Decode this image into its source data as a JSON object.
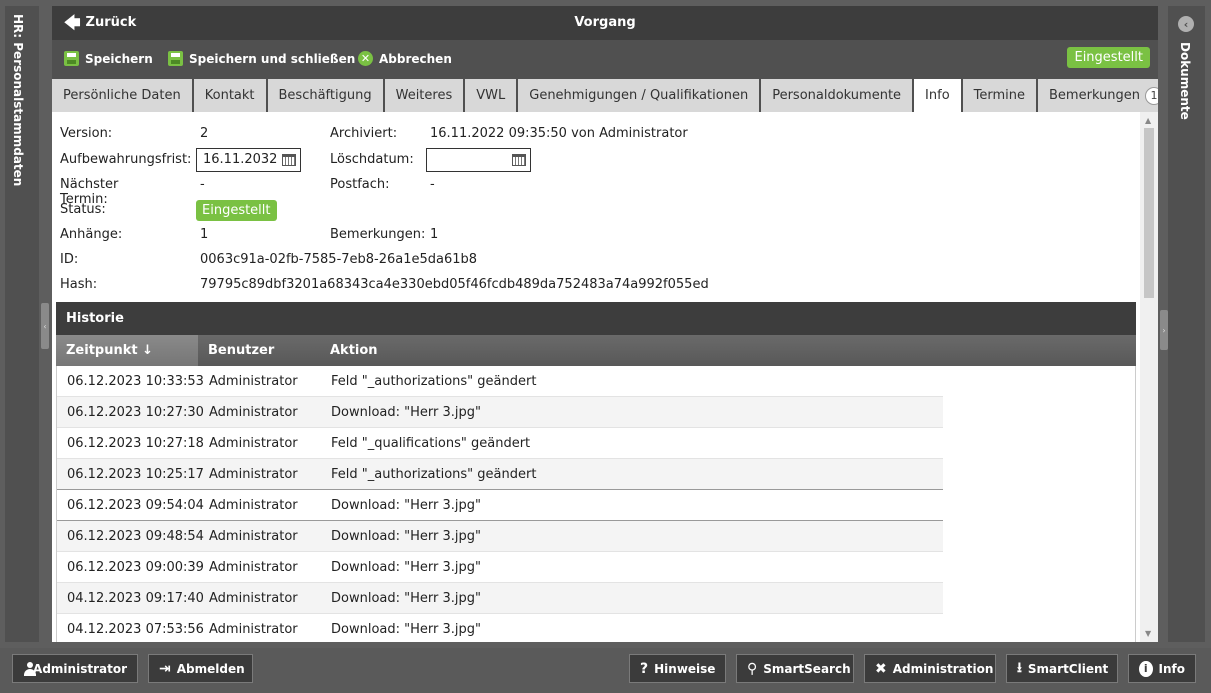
{
  "left_panel": {
    "label": "HR: Personalstammdaten"
  },
  "right_panel": {
    "label": "Dokumente"
  },
  "header": {
    "back_label": "Zurück",
    "title": "Vorgang"
  },
  "toolbar": {
    "save_label": "Speichern",
    "save_close_label": "Speichern und schließen",
    "cancel_label": "Abbrechen",
    "status_label": "Eingestellt",
    "status_color": "#7ac143"
  },
  "tabs": [
    {
      "label": "Persönliche Daten"
    },
    {
      "label": "Kontakt"
    },
    {
      "label": "Beschäftigung"
    },
    {
      "label": "Weiteres"
    },
    {
      "label": "VWL"
    },
    {
      "label": "Genehmigungen / Qualifikationen"
    },
    {
      "label": "Personaldokumente"
    },
    {
      "label": "Info",
      "active": true
    },
    {
      "label": "Termine"
    },
    {
      "label": "Bemerkungen",
      "count": "1"
    }
  ],
  "info": {
    "version_label": "Version:",
    "version_value": "2",
    "archived_label": "Archiviert:",
    "archived_value": "16.11.2022 09:35:50 von Administrator",
    "retention_label": "Aufbewahrungsfrist:",
    "retention_value": "16.11.2032",
    "deletion_label": "Löschdatum:",
    "deletion_value": "",
    "next_date_label": "Nächster Termin:",
    "next_date_value": "-",
    "mailbox_label": "Postfach:",
    "mailbox_value": "-",
    "status_label": "Status:",
    "status_value": "Eingestellt",
    "attachments_label": "Anhänge:",
    "attachments_value": "1",
    "remarks_label": "Bemerkungen:",
    "remarks_value": "1",
    "id_label": "ID:",
    "id_value": "0063c91a-02fb-7585-7eb8-26a1e5da61b8",
    "hash_label": "Hash:",
    "hash_value": "79795c89dbf3201a68343ca4e330ebd05f46fcdb489da752483a74a992f055ed"
  },
  "history": {
    "title": "Historie",
    "columns": [
      "Zeitpunkt ↓",
      "Benutzer",
      "Aktion"
    ],
    "rows": [
      [
        "06.12.2023 10:33:53",
        "Administrator",
        "Feld \"_authorizations\" geändert"
      ],
      [
        "06.12.2023 10:27:30",
        "Administrator",
        "Download: \"Herr 3.jpg\""
      ],
      [
        "06.12.2023 10:27:18",
        "Administrator",
        "Feld \"_qualifications\" geändert"
      ],
      [
        "06.12.2023 10:25:17",
        "Administrator",
        "Feld \"_authorizations\" geändert"
      ],
      [
        "06.12.2023 09:54:04",
        "Administrator",
        "Download: \"Herr 3.jpg\""
      ],
      [
        "06.12.2023 09:48:54",
        "Administrator",
        "Download: \"Herr 3.jpg\""
      ],
      [
        "06.12.2023 09:00:39",
        "Administrator",
        "Download: \"Herr 3.jpg\""
      ],
      [
        "04.12.2023 09:17:40",
        "Administrator",
        "Download: \"Herr 3.jpg\""
      ],
      [
        "04.12.2023 07:53:56",
        "Administrator",
        "Download: \"Herr 3.jpg\""
      ]
    ]
  },
  "bottom_bar": {
    "user_label": "Administrator",
    "logout_label": "Abmelden",
    "hints_label": "Hinweise",
    "smartsearch_label": "SmartSearch",
    "admin_label": "Administration",
    "smartclient_label": "SmartClient",
    "info_label": "Info"
  }
}
